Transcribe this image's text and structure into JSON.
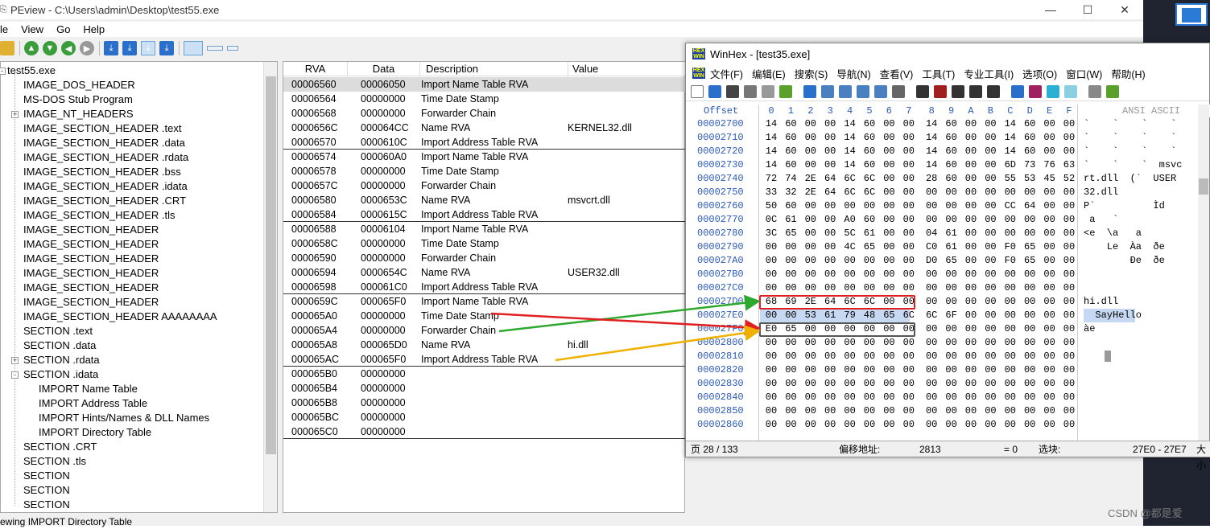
{
  "peview": {
    "title": "PEview - C:\\Users\\admin\\Desktop\\test55.exe",
    "window_buttons": [
      "—",
      "☐",
      "✕"
    ],
    "menu": [
      "le",
      "View",
      "Go",
      "Help"
    ],
    "status": "ewing IMPORT Directory Table",
    "tree": [
      {
        "label": "test55.exe",
        "level": 0,
        "expander": "-"
      },
      {
        "label": "IMAGE_DOS_HEADER",
        "level": 1,
        "expander": ""
      },
      {
        "label": "MS-DOS Stub Program",
        "level": 1,
        "expander": ""
      },
      {
        "label": "IMAGE_NT_HEADERS",
        "level": 1,
        "expander": "+"
      },
      {
        "label": "IMAGE_SECTION_HEADER .text",
        "level": 1,
        "expander": ""
      },
      {
        "label": "IMAGE_SECTION_HEADER .data",
        "level": 1,
        "expander": ""
      },
      {
        "label": "IMAGE_SECTION_HEADER .rdata",
        "level": 1,
        "expander": ""
      },
      {
        "label": "IMAGE_SECTION_HEADER .bss",
        "level": 1,
        "expander": ""
      },
      {
        "label": "IMAGE_SECTION_HEADER .idata",
        "level": 1,
        "expander": ""
      },
      {
        "label": "IMAGE_SECTION_HEADER .CRT",
        "level": 1,
        "expander": ""
      },
      {
        "label": "IMAGE_SECTION_HEADER .tls",
        "level": 1,
        "expander": ""
      },
      {
        "label": "IMAGE_SECTION_HEADER",
        "level": 1,
        "expander": ""
      },
      {
        "label": "IMAGE_SECTION_HEADER",
        "level": 1,
        "expander": ""
      },
      {
        "label": "IMAGE_SECTION_HEADER",
        "level": 1,
        "expander": ""
      },
      {
        "label": "IMAGE_SECTION_HEADER",
        "level": 1,
        "expander": ""
      },
      {
        "label": "IMAGE_SECTION_HEADER",
        "level": 1,
        "expander": ""
      },
      {
        "label": "IMAGE_SECTION_HEADER",
        "level": 1,
        "expander": ""
      },
      {
        "label": "IMAGE_SECTION_HEADER AAAAAAAA",
        "level": 1,
        "expander": ""
      },
      {
        "label": "SECTION .text",
        "level": 1,
        "expander": ""
      },
      {
        "label": "SECTION .data",
        "level": 1,
        "expander": ""
      },
      {
        "label": "SECTION .rdata",
        "level": 1,
        "expander": "+"
      },
      {
        "label": "SECTION .idata",
        "level": 1,
        "expander": "-"
      },
      {
        "label": "IMPORT Name Table",
        "level": 2,
        "expander": ""
      },
      {
        "label": "IMPORT Address Table",
        "level": 2,
        "expander": ""
      },
      {
        "label": "IMPORT Hints/Names & DLL Names",
        "level": 2,
        "expander": ""
      },
      {
        "label": "IMPORT Directory Table",
        "level": 2,
        "expander": ""
      },
      {
        "label": "SECTION .CRT",
        "level": 1,
        "expander": ""
      },
      {
        "label": "SECTION .tls",
        "level": 1,
        "expander": ""
      },
      {
        "label": "SECTION",
        "level": 1,
        "expander": ""
      },
      {
        "label": "SECTION",
        "level": 1,
        "expander": ""
      },
      {
        "label": "SECTION",
        "level": 1,
        "expander": ""
      }
    ],
    "grid_headers": [
      "RVA",
      "Data",
      "Description",
      "Value"
    ],
    "grid_rows": [
      {
        "rva": "00006560",
        "data": "00006050",
        "desc": "Import Name Table RVA",
        "value": "",
        "hl": true
      },
      {
        "rva": "00006564",
        "data": "00000000",
        "desc": "Time Date Stamp",
        "value": ""
      },
      {
        "rva": "00006568",
        "data": "00000000",
        "desc": "Forwarder Chain",
        "value": ""
      },
      {
        "rva": "0000656C",
        "data": "000064CC",
        "desc": "Name RVA",
        "value": "KERNEL32.dll"
      },
      {
        "rva": "00006570",
        "data": "0000610C",
        "desc": "Import Address Table RVA",
        "value": ""
      },
      {
        "rva": "00006574",
        "data": "000060A0",
        "desc": "Import Name Table RVA",
        "value": ""
      },
      {
        "rva": "00006578",
        "data": "00000000",
        "desc": "Time Date Stamp",
        "value": ""
      },
      {
        "rva": "0000657C",
        "data": "00000000",
        "desc": "Forwarder Chain",
        "value": ""
      },
      {
        "rva": "00006580",
        "data": "0000653C",
        "desc": "Name RVA",
        "value": "msvcrt.dll"
      },
      {
        "rva": "00006584",
        "data": "0000615C",
        "desc": "Import Address Table RVA",
        "value": ""
      },
      {
        "rva": "00006588",
        "data": "00006104",
        "desc": "Import Name Table RVA",
        "value": ""
      },
      {
        "rva": "0000658C",
        "data": "00000000",
        "desc": "Time Date Stamp",
        "value": ""
      },
      {
        "rva": "00006590",
        "data": "00000000",
        "desc": "Forwarder Chain",
        "value": ""
      },
      {
        "rva": "00006594",
        "data": "0000654C",
        "desc": "Name RVA",
        "value": "USER32.dll"
      },
      {
        "rva": "00006598",
        "data": "000061C0",
        "desc": "Import Address Table RVA",
        "value": ""
      },
      {
        "rva": "0000659C",
        "data": "000065F0",
        "desc": "Import Name Table RVA",
        "value": ""
      },
      {
        "rva": "000065A0",
        "data": "00000000",
        "desc": "Time Date Stamp",
        "value": ""
      },
      {
        "rva": "000065A4",
        "data": "00000000",
        "desc": "Forwarder Chain",
        "value": ""
      },
      {
        "rva": "000065A8",
        "data": "000065D0",
        "desc": "Name RVA",
        "value": "hi.dll"
      },
      {
        "rva": "000065AC",
        "data": "000065F0",
        "desc": "Import Address Table RVA",
        "value": ""
      },
      {
        "rva": "000065B0",
        "data": "00000000",
        "desc": "",
        "value": ""
      },
      {
        "rva": "000065B4",
        "data": "00000000",
        "desc": "",
        "value": ""
      },
      {
        "rva": "000065B8",
        "data": "00000000",
        "desc": "",
        "value": ""
      },
      {
        "rva": "000065BC",
        "data": "00000000",
        "desc": "",
        "value": ""
      },
      {
        "rva": "000065C0",
        "data": "00000000",
        "desc": "",
        "value": ""
      }
    ]
  },
  "winhex": {
    "title": "WinHex - [test35.exe]",
    "menu": [
      "文件(F)",
      "编辑(E)",
      "搜索(S)",
      "导航(N)",
      "查看(V)",
      "工具(T)",
      "专业工具(I)",
      "选项(O)",
      "窗口(W)",
      "帮助(H)"
    ],
    "header_offset": "Offset",
    "header_cols": [
      "0",
      "1",
      "2",
      "3",
      "4",
      "5",
      "6",
      "7",
      "8",
      "9",
      "A",
      "B",
      "C",
      "D",
      "E",
      "F"
    ],
    "header_ascii": "ANSI ASCII",
    "rows": [
      {
        "off": "00002700",
        "bytes": [
          "14",
          "60",
          "00",
          "00",
          "14",
          "60",
          "00",
          "00",
          "14",
          "60",
          "00",
          "00",
          "14",
          "60",
          "00",
          "00"
        ],
        "ascii": "`    `    `    `"
      },
      {
        "off": "00002710",
        "bytes": [
          "14",
          "60",
          "00",
          "00",
          "14",
          "60",
          "00",
          "00",
          "14",
          "60",
          "00",
          "00",
          "14",
          "60",
          "00",
          "00"
        ],
        "ascii": "`    `    `    `"
      },
      {
        "off": "00002720",
        "bytes": [
          "14",
          "60",
          "00",
          "00",
          "14",
          "60",
          "00",
          "00",
          "14",
          "60",
          "00",
          "00",
          "14",
          "60",
          "00",
          "00"
        ],
        "ascii": "`    `    `    `"
      },
      {
        "off": "00002730",
        "bytes": [
          "14",
          "60",
          "00",
          "00",
          "14",
          "60",
          "00",
          "00",
          "14",
          "60",
          "00",
          "00",
          "6D",
          "73",
          "76",
          "63"
        ],
        "ascii": "`    `    `  msvc"
      },
      {
        "off": "00002740",
        "bytes": [
          "72",
          "74",
          "2E",
          "64",
          "6C",
          "6C",
          "00",
          "00",
          "28",
          "60",
          "00",
          "00",
          "55",
          "53",
          "45",
          "52"
        ],
        "ascii": "rt.dll  (`  USER"
      },
      {
        "off": "00002750",
        "bytes": [
          "33",
          "32",
          "2E",
          "64",
          "6C",
          "6C",
          "00",
          "00",
          "00",
          "00",
          "00",
          "00",
          "00",
          "00",
          "00",
          "00"
        ],
        "ascii": "32.dll"
      },
      {
        "off": "00002760",
        "bytes": [
          "50",
          "60",
          "00",
          "00",
          "00",
          "00",
          "00",
          "00",
          "00",
          "00",
          "00",
          "00",
          "CC",
          "64",
          "00",
          "00"
        ],
        "ascii": "P`          Ìd"
      },
      {
        "off": "00002770",
        "bytes": [
          "0C",
          "61",
          "00",
          "00",
          "A0",
          "60",
          "00",
          "00",
          "00",
          "00",
          "00",
          "00",
          "00",
          "00",
          "00",
          "00"
        ],
        "ascii": " a   `"
      },
      {
        "off": "00002780",
        "bytes": [
          "3C",
          "65",
          "00",
          "00",
          "5C",
          "61",
          "00",
          "00",
          "04",
          "61",
          "00",
          "00",
          "00",
          "00",
          "00",
          "00"
        ],
        "ascii": "<e  \\a   a"
      },
      {
        "off": "00002790",
        "bytes": [
          "00",
          "00",
          "00",
          "00",
          "4C",
          "65",
          "00",
          "00",
          "C0",
          "61",
          "00",
          "00",
          "F0",
          "65",
          "00",
          "00"
        ],
        "ascii": "    Le  Àa  ðe"
      },
      {
        "off": "000027A0",
        "bytes": [
          "00",
          "00",
          "00",
          "00",
          "00",
          "00",
          "00",
          "00",
          "D0",
          "65",
          "00",
          "00",
          "F0",
          "65",
          "00",
          "00"
        ],
        "ascii": "        Ðe  ðe"
      },
      {
        "off": "000027B0",
        "bytes": [
          "00",
          "00",
          "00",
          "00",
          "00",
          "00",
          "00",
          "00",
          "00",
          "00",
          "00",
          "00",
          "00",
          "00",
          "00",
          "00"
        ],
        "ascii": ""
      },
      {
        "off": "000027C0",
        "bytes": [
          "00",
          "00",
          "00",
          "00",
          "00",
          "00",
          "00",
          "00",
          "00",
          "00",
          "00",
          "00",
          "00",
          "00",
          "00",
          "00"
        ],
        "ascii": ""
      },
      {
        "off": "000027D0",
        "bytes": [
          "68",
          "69",
          "2E",
          "64",
          "6C",
          "6C",
          "00",
          "00",
          "00",
          "00",
          "00",
          "00",
          "00",
          "00",
          "00",
          "00"
        ],
        "ascii": "hi.dll"
      },
      {
        "off": "000027E0",
        "bytes": [
          "00",
          "00",
          "53",
          "61",
          "79",
          "48",
          "65",
          "6C",
          "6C",
          "6F",
          "00",
          "00",
          "00",
          "00",
          "00",
          "00"
        ],
        "ascii": "  SayHello"
      },
      {
        "off": "000027F0",
        "bytes": [
          "E0",
          "65",
          "00",
          "00",
          "00",
          "00",
          "00",
          "00",
          "00",
          "00",
          "00",
          "00",
          "00",
          "00",
          "00",
          "00"
        ],
        "ascii": "àe"
      },
      {
        "off": "00002800",
        "bytes": [
          "00",
          "00",
          "00",
          "00",
          "00",
          "00",
          "00",
          "00",
          "00",
          "00",
          "00",
          "00",
          "00",
          "00",
          "00",
          "00"
        ],
        "ascii": ""
      },
      {
        "off": "00002810",
        "bytes": [
          "00",
          "00",
          "00",
          "00",
          "00",
          "00",
          "00",
          "00",
          "00",
          "00",
          "00",
          "00",
          "00",
          "00",
          "00",
          "00"
        ],
        "ascii": ""
      },
      {
        "off": "00002820",
        "bytes": [
          "00",
          "00",
          "00",
          "00",
          "00",
          "00",
          "00",
          "00",
          "00",
          "00",
          "00",
          "00",
          "00",
          "00",
          "00",
          "00"
        ],
        "ascii": ""
      },
      {
        "off": "00002830",
        "bytes": [
          "00",
          "00",
          "00",
          "00",
          "00",
          "00",
          "00",
          "00",
          "00",
          "00",
          "00",
          "00",
          "00",
          "00",
          "00",
          "00"
        ],
        "ascii": ""
      },
      {
        "off": "00002840",
        "bytes": [
          "00",
          "00",
          "00",
          "00",
          "00",
          "00",
          "00",
          "00",
          "00",
          "00",
          "00",
          "00",
          "00",
          "00",
          "00",
          "00"
        ],
        "ascii": ""
      },
      {
        "off": "00002850",
        "bytes": [
          "00",
          "00",
          "00",
          "00",
          "00",
          "00",
          "00",
          "00",
          "00",
          "00",
          "00",
          "00",
          "00",
          "00",
          "00",
          "00"
        ],
        "ascii": ""
      },
      {
        "off": "00002860",
        "bytes": [
          "00",
          "00",
          "00",
          "00",
          "00",
          "00",
          "00",
          "00",
          "00",
          "00",
          "00",
          "00",
          "00",
          "00",
          "00",
          "00"
        ],
        "ascii": ""
      }
    ],
    "status": {
      "page": "页 28 / 133",
      "offset_label": "偏移地址:",
      "offset_value": "2813",
      "eq": "= 0",
      "sel_label": "选块:",
      "sel_value": "27E0 - 27E7",
      "size_label": "大小"
    }
  },
  "watermark": "CSDN @都是爱"
}
